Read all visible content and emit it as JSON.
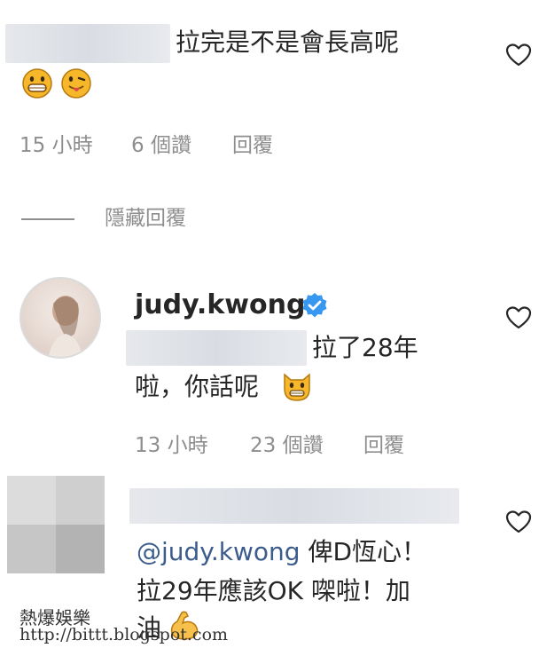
{
  "comment1": {
    "text": "拉完是不是會長高呢",
    "emojis": [
      "grinning-face-icon",
      "tongue-face-icon"
    ],
    "time": "15 小時",
    "likes": "6 個讚",
    "reply": "回覆"
  },
  "hide_replies": "隱藏回覆",
  "comment2": {
    "username": "judy.kwong",
    "text_line1": "拉了28年",
    "text_line2": "啦，你話呢",
    "time": "13 小時",
    "likes": "23 個讚",
    "reply": "回覆"
  },
  "comment3": {
    "mention": "@judy.kwong",
    "text_line1_rest": " 俾D恆心！",
    "text_line2": "拉29年應該OK 㗎啦！加",
    "text_line3": "油"
  },
  "watermark": {
    "line1": "熱爆娛樂",
    "line2": "http://bittt.blogspot.com"
  },
  "colors": {
    "text": "#262626",
    "meta": "#8e8e8e",
    "mention": "#3b5c8c",
    "verified": "#3897f0"
  }
}
